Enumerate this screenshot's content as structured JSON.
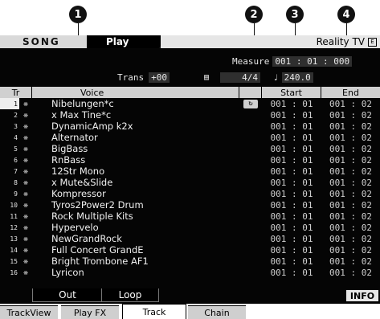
{
  "callouts": [
    "1",
    "2",
    "3",
    "4"
  ],
  "header": {
    "mode": "SONG",
    "submode": "Play",
    "song_title": "Reality TV",
    "measure_label": "Measure",
    "measure_value": "001 : 01 : 000",
    "trans_label": "Trans",
    "trans_value": "+00",
    "meter_icon": "metronome-icon",
    "time_signature": "4/4",
    "tempo_icon": "note-icon",
    "tempo_value": "240.0"
  },
  "table": {
    "headers": {
      "tr": "Tr",
      "voice": "Voice",
      "start": "Start",
      "end": "End"
    },
    "rows": [
      {
        "tr": "1",
        "voice": "Nibelungen*c",
        "start": "001 : 01",
        "end": "001 : 02",
        "loop": true
      },
      {
        "tr": "2",
        "voice": "x Max Tine*c",
        "start": "001 : 01",
        "end": "001 : 02"
      },
      {
        "tr": "3",
        "voice": "DynamicAmp k2x",
        "start": "001 : 01",
        "end": "001 : 02"
      },
      {
        "tr": "4",
        "voice": "Alternator",
        "start": "001 : 01",
        "end": "001 : 02"
      },
      {
        "tr": "5",
        "voice": "BigBass",
        "start": "001 : 01",
        "end": "001 : 02"
      },
      {
        "tr": "6",
        "voice": "RnBass",
        "start": "001 : 01",
        "end": "001 : 02"
      },
      {
        "tr": "7",
        "voice": "12Str Mono",
        "start": "001 : 01",
        "end": "001 : 02"
      },
      {
        "tr": "8",
        "voice": "x Mute&Slide",
        "start": "001 : 01",
        "end": "001 : 02"
      },
      {
        "tr": "9",
        "voice": "Kompressor",
        "start": "001 : 01",
        "end": "001 : 02"
      },
      {
        "tr": "10",
        "voice": "Tyros2Power2 Drum",
        "start": "001 : 01",
        "end": "001 : 02"
      },
      {
        "tr": "11",
        "voice": "Rock Multiple Kits",
        "start": "001 : 01",
        "end": "001 : 02"
      },
      {
        "tr": "12",
        "voice": "Hypervelo",
        "start": "001 : 01",
        "end": "001 : 02"
      },
      {
        "tr": "13",
        "voice": "NewGrandRock",
        "start": "001 : 01",
        "end": "001 : 02"
      },
      {
        "tr": "14",
        "voice": "Full Concert GrandE",
        "start": "001 : 01",
        "end": "001 : 02"
      },
      {
        "tr": "15",
        "voice": "Bright Trombone AF1",
        "start": "001 : 01",
        "end": "001 : 02"
      },
      {
        "tr": "16",
        "voice": "Lyricon",
        "start": "001 : 01",
        "end": "001 : 02"
      }
    ]
  },
  "sub_tabs": {
    "out": "Out",
    "loop": "Loop"
  },
  "info_button": "INFO",
  "footer_tabs": [
    "TrackView",
    "Play FX",
    "Track",
    "Chain"
  ]
}
